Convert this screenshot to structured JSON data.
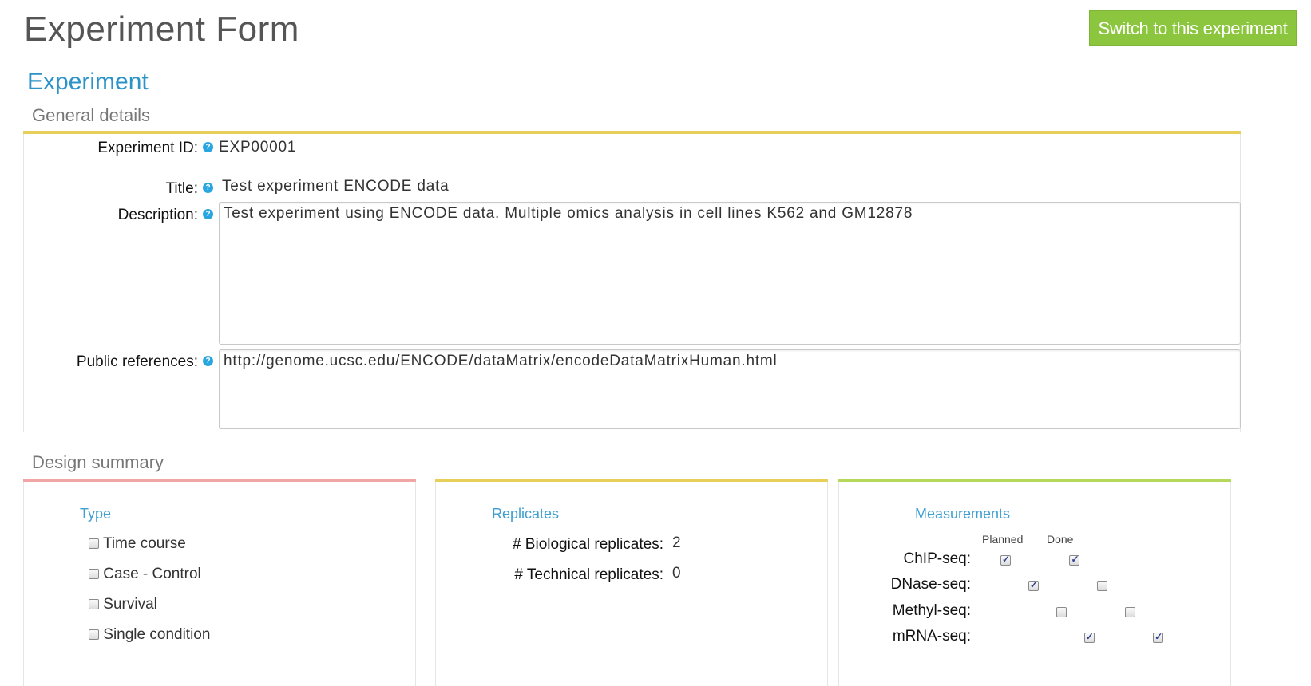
{
  "header": {
    "title": "Experiment Form",
    "switch_button": "Switch to this experiment"
  },
  "experiment": {
    "section_title": "Experiment",
    "general": {
      "title": "General details",
      "fields": {
        "experiment_id_label": "Experiment ID:",
        "experiment_id_value": "EXP00001",
        "title_label": "Title:",
        "title_value": "Test experiment ENCODE data",
        "description_label": "Description:",
        "description_value": "Test experiment using ENCODE data. Multiple omics analysis in cell lines K562 and GM12878",
        "public_refs_label": "Public references:",
        "public_refs_value": "http://genome.ucsc.edu/ENCODE/dataMatrix/encodeDataMatrixHuman.html"
      },
      "help_glyph": "?"
    },
    "design_summary": {
      "title": "Design summary",
      "type": {
        "heading": "Type",
        "items": [
          {
            "label": "Time course",
            "checked": false
          },
          {
            "label": "Case - Control",
            "checked": false
          },
          {
            "label": "Survival",
            "checked": false
          },
          {
            "label": "Single condition",
            "checked": false
          }
        ]
      },
      "replicates": {
        "heading": "Replicates",
        "biological_label": "# Biological replicates:",
        "biological_value": "2",
        "technical_label": "# Technical replicates:",
        "technical_value": "0"
      },
      "measurements": {
        "heading": "Measurements",
        "col_planned": "Planned",
        "col_done": "Done",
        "rows": [
          {
            "label": "ChIP-seq:",
            "planned": true,
            "done": true
          },
          {
            "label": "DNase-seq:",
            "planned": true,
            "done": false
          },
          {
            "label": "Methyl-seq:",
            "planned": false,
            "done": false
          },
          {
            "label": "mRNA-seq:",
            "planned": true,
            "done": true
          }
        ]
      }
    }
  },
  "colors": {
    "accent_blue": "#2b93c8",
    "button_green": "#8cc63f",
    "bar_yellow": "#e8cf5a",
    "bar_pink": "#f2a5a5",
    "bar_green": "#b6d85a"
  }
}
